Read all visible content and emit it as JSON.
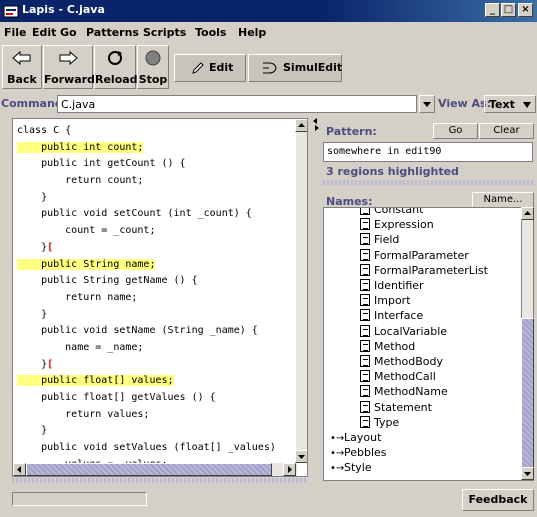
{
  "window": {
    "title": "Lapis - C.java",
    "min": "_",
    "max": "□",
    "close": "×"
  },
  "menu": [
    "File",
    "Edit",
    "Go",
    "Patterns",
    "Scripts",
    "Tools",
    "Help"
  ],
  "toolbar": {
    "back": "Back",
    "forward": "Forward",
    "reload": "Reload",
    "stop": "Stop",
    "edit": "Edit",
    "simuledit": "SimulEdit"
  },
  "command": {
    "label": "Command:",
    "value": "C.java"
  },
  "view_as": {
    "label": "View As:",
    "value": "Text"
  },
  "editor": {
    "lines": [
      {
        "text": "class C {",
        "hl": false
      },
      {
        "text": "    public int count;",
        "hl": true
      },
      {
        "text": "    public int getCount () {",
        "hl": false
      },
      {
        "text": "        return count;",
        "hl": false
      },
      {
        "text": "    }",
        "hl": false
      },
      {
        "text": "    public void setCount (int _count) {",
        "hl": false
      },
      {
        "text": "        count = _count;",
        "hl": false
      },
      {
        "text": "    }",
        "hl": false,
        "cursor": true
      },
      {
        "text": "    public String name;",
        "hl": true
      },
      {
        "text": "    public String getName () {",
        "hl": false
      },
      {
        "text": "        return name;",
        "hl": false
      },
      {
        "text": "    }",
        "hl": false
      },
      {
        "text": "    public void setName (String _name) {",
        "hl": false
      },
      {
        "text": "        name = _name;",
        "hl": false
      },
      {
        "text": "    }",
        "hl": false,
        "cursor": true
      },
      {
        "text": "    public float[] values;",
        "hl": true
      },
      {
        "text": "    public float[] getValues () {",
        "hl": false
      },
      {
        "text": "        return values;",
        "hl": false
      },
      {
        "text": "    }",
        "hl": false
      },
      {
        "text": "    public void setValues (float[] _values)",
        "hl": false
      },
      {
        "text": "        values = _values;",
        "hl": false
      },
      {
        "text": "    }",
        "hl": false,
        "cursor": true
      }
    ]
  },
  "pattern": {
    "label": "Pattern:",
    "go": "Go",
    "clear": "Clear",
    "value": "somewhere in edit90",
    "status": "3 regions highlighted"
  },
  "names": {
    "label": "Names:",
    "button": "Name...",
    "leaf_items": [
      "Constant",
      "Expression",
      "Field",
      "FormalParameter",
      "FormalParameterList",
      "Identifier",
      "Import",
      "Interface",
      "LocalVariable",
      "Method",
      "MethodBody",
      "MethodCall",
      "MethodName",
      "Statement",
      "Type"
    ],
    "folders": [
      "Layout",
      "Pebbles",
      "Style"
    ]
  },
  "status": {
    "feedback": "Feedback"
  },
  "colors": {
    "title_bar": "#0a246a",
    "highlight": "#ffff80",
    "section_label": "#4c4c80",
    "cursor": "#e00000"
  }
}
